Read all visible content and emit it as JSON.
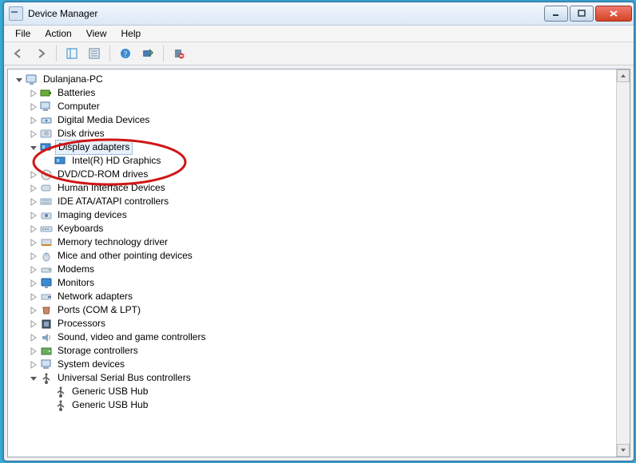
{
  "window": {
    "title": "Device Manager"
  },
  "menubar": [
    "File",
    "Action",
    "View",
    "Help"
  ],
  "root": "Dulanjana-PC",
  "nodes": {
    "batteries": "Batteries",
    "computer": "Computer",
    "dmd": "Digital Media Devices",
    "disk": "Disk drives",
    "display": "Display adapters",
    "display_child": "Intel(R) HD Graphics",
    "dvd": "DVD/CD-ROM drives",
    "hid": "Human Interface Devices",
    "ide": "IDE ATA/ATAPI controllers",
    "imaging": "Imaging devices",
    "keyboards": "Keyboards",
    "memtech": "Memory technology driver",
    "mice": "Mice and other pointing devices",
    "modems": "Modems",
    "monitors": "Monitors",
    "netadapters": "Network adapters",
    "ports": "Ports (COM & LPT)",
    "processors": "Processors",
    "svgc": "Sound, video and game controllers",
    "storage": "Storage controllers",
    "sysdev": "System devices",
    "usb": "Universal Serial Bus controllers",
    "usb_child1": "Generic USB Hub",
    "usb_child2": "Generic USB Hub"
  }
}
